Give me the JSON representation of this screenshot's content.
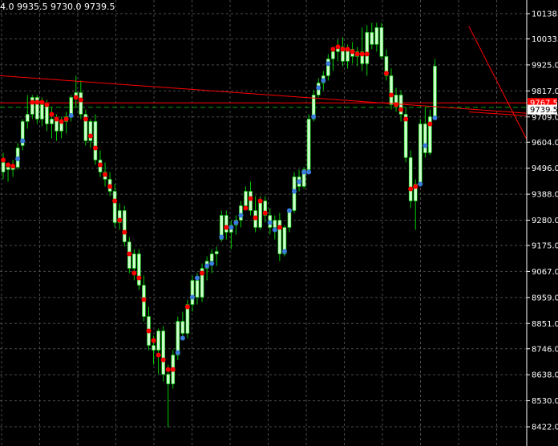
{
  "ohlc_readout": "4.0 9935.5 9730.0 9739.5",
  "colors": {
    "background": "#000000",
    "grid": "#4a4a4a",
    "axis": "#ffffff",
    "candle_body": "#ccffcc",
    "wick": "#00cc00",
    "dot_red": "#ff0000",
    "dot_blue": "#3b7bdc",
    "trendline": "#ff0000",
    "hline_red": "#ff0000",
    "hline_green": "#00a000",
    "tag_red": "#ff0000",
    "tag_bg_white": "#ffffff"
  },
  "chart_data": {
    "type": "candlestick",
    "ylim": [
      8380,
      10200
    ],
    "y_ticks": [
      "10138.0",
      "10033.0",
      "9925.0",
      "9817.0",
      "9709.0",
      "9604.0",
      "9496.0",
      "9388.0",
      "9280.0",
      "9175.0",
      "9067.0",
      "8959.0",
      "8851.0",
      "8746.0",
      "8638.0",
      "8530.0",
      "8422.0"
    ],
    "y_tick_values": [
      10138,
      10033,
      9925,
      9817,
      9709,
      9604,
      9496,
      9388,
      9280,
      9175,
      9067,
      8959,
      8851,
      8746,
      8638,
      8530,
      8422
    ],
    "price_tags": [
      {
        "label": "9767.5",
        "value": 9767.5,
        "style": "red"
      },
      {
        "label": "9739.5",
        "value": 9739.5,
        "style": "white"
      }
    ],
    "horizontal_lines": [
      {
        "value": 9767.5,
        "style": "red"
      },
      {
        "value": 9749,
        "style": "green-dashed"
      }
    ],
    "trendlines": [
      {
        "p1": [
          0,
          9880
        ],
        "p2": [
          111,
          9720
        ]
      },
      {
        "p1": [
          96,
          10085
        ],
        "p2": [
          111,
          9495
        ]
      },
      {
        "p1": [
          96,
          9730
        ],
        "p2": [
          111,
          9710
        ]
      }
    ],
    "candles": [
      {
        "o": 9520,
        "h": 9560,
        "l": 9450,
        "c": 9480,
        "dot": "red",
        "dv": 9530
      },
      {
        "o": 9490,
        "h": 9510,
        "l": 9440,
        "c": 9500,
        "dot": "red",
        "dv": 9510
      },
      {
        "o": 9500,
        "h": 9530,
        "l": 9460,
        "c": 9490,
        "dot": "red",
        "dv": 9505
      },
      {
        "o": 9500,
        "h": 9600,
        "l": 9490,
        "c": 9580,
        "dot": "blue",
        "dv": 9535
      },
      {
        "o": 9590,
        "h": 9700,
        "l": 9570,
        "c": 9690,
        "dot": "blue",
        "dv": 9610
      },
      {
        "o": 9690,
        "h": 9800,
        "l": 9660,
        "c": 9720,
        "dot": null,
        "dv": 0
      },
      {
        "o": 9720,
        "h": 9800,
        "l": 9700,
        "c": 9790,
        "dot": "red",
        "dv": 9770
      },
      {
        "o": 9790,
        "h": 9800,
        "l": 9680,
        "c": 9700,
        "dot": "red",
        "dv": 9770
      },
      {
        "o": 9700,
        "h": 9790,
        "l": 9670,
        "c": 9760,
        "dot": "red",
        "dv": 9770
      },
      {
        "o": 9760,
        "h": 9780,
        "l": 9650,
        "c": 9680,
        "dot": "red",
        "dv": 9760
      },
      {
        "o": 9680,
        "h": 9750,
        "l": 9620,
        "c": 9700,
        "dot": "red",
        "dv": 9720
      },
      {
        "o": 9700,
        "h": 9720,
        "l": 9610,
        "c": 9650,
        "dot": "red",
        "dv": 9700
      },
      {
        "o": 9650,
        "h": 9710,
        "l": 9620,
        "c": 9690,
        "dot": "red",
        "dv": 9690
      },
      {
        "o": 9690,
        "h": 9730,
        "l": 9640,
        "c": 9710,
        "dot": "red",
        "dv": 9700
      },
      {
        "o": 9710,
        "h": 9800,
        "l": 9690,
        "c": 9790,
        "dot": "blue",
        "dv": 9715
      },
      {
        "o": 9790,
        "h": 9880,
        "l": 9750,
        "c": 9810,
        "dot": "red",
        "dv": 9790
      },
      {
        "o": 9810,
        "h": 9860,
        "l": 9700,
        "c": 9720,
        "dot": "red",
        "dv": 9780
      },
      {
        "o": 9720,
        "h": 9740,
        "l": 9590,
        "c": 9610,
        "dot": "red",
        "dv": 9700
      },
      {
        "o": 9610,
        "h": 9700,
        "l": 9580,
        "c": 9690,
        "dot": "red",
        "dv": 9630
      },
      {
        "o": 9690,
        "h": 9720,
        "l": 9510,
        "c": 9530,
        "dot": "red",
        "dv": 9580
      },
      {
        "o": 9530,
        "h": 9570,
        "l": 9460,
        "c": 9480,
        "dot": "red",
        "dv": 9510
      },
      {
        "o": 9480,
        "h": 9520,
        "l": 9420,
        "c": 9450,
        "dot": "red",
        "dv": 9470
      },
      {
        "o": 9450,
        "h": 9480,
        "l": 9380,
        "c": 9400,
        "dot": "red",
        "dv": 9420
      },
      {
        "o": 9400,
        "h": 9430,
        "l": 9250,
        "c": 9270,
        "dot": "red",
        "dv": 9360
      },
      {
        "o": 9270,
        "h": 9350,
        "l": 9240,
        "c": 9320,
        "dot": "red",
        "dv": 9280
      },
      {
        "o": 9320,
        "h": 9340,
        "l": 9170,
        "c": 9190,
        "dot": "red",
        "dv": 9230
      },
      {
        "o": 9190,
        "h": 9210,
        "l": 9060,
        "c": 9080,
        "dot": "red",
        "dv": 9140
      },
      {
        "o": 9080,
        "h": 9160,
        "l": 9030,
        "c": 9140,
        "dot": "red",
        "dv": 9060
      },
      {
        "o": 9140,
        "h": 9160,
        "l": 8990,
        "c": 9010,
        "dot": "red",
        "dv": 9040
      },
      {
        "o": 9010,
        "h": 9050,
        "l": 8860,
        "c": 8880,
        "dot": "red",
        "dv": 8950
      },
      {
        "o": 8880,
        "h": 8920,
        "l": 8740,
        "c": 8760,
        "dot": "red",
        "dv": 8820
      },
      {
        "o": 8760,
        "h": 8800,
        "l": 8680,
        "c": 8740,
        "dot": "red",
        "dv": 8780
      },
      {
        "o": 8740,
        "h": 8830,
        "l": 8640,
        "c": 8820,
        "dot": "red",
        "dv": 8720
      },
      {
        "o": 8820,
        "h": 8840,
        "l": 8610,
        "c": 8640,
        "dot": "red",
        "dv": 8700
      },
      {
        "o": 8640,
        "h": 8680,
        "l": 8420,
        "c": 8600,
        "dot": "red",
        "dv": 8660
      },
      {
        "o": 8600,
        "h": 8740,
        "l": 8580,
        "c": 8720,
        "dot": "red",
        "dv": 8660
      },
      {
        "o": 8720,
        "h": 8880,
        "l": 8700,
        "c": 8860,
        "dot": "blue",
        "dv": 8730
      },
      {
        "o": 8860,
        "h": 8900,
        "l": 8780,
        "c": 8810,
        "dot": "blue",
        "dv": 8790
      },
      {
        "o": 8810,
        "h": 8950,
        "l": 8790,
        "c": 8930,
        "dot": "red",
        "dv": 8920
      },
      {
        "o": 8930,
        "h": 9050,
        "l": 8900,
        "c": 9030,
        "dot": "blue",
        "dv": 8960
      },
      {
        "o": 9030,
        "h": 9060,
        "l": 8930,
        "c": 8960,
        "dot": "blue",
        "dv": 9040
      },
      {
        "o": 8960,
        "h": 9100,
        "l": 8940,
        "c": 9080,
        "dot": "red",
        "dv": 9060
      },
      {
        "o": 9080,
        "h": 9130,
        "l": 9030,
        "c": 9110,
        "dot": "blue",
        "dv": 9090
      },
      {
        "o": 9110,
        "h": 9160,
        "l": 9060,
        "c": 9140,
        "dot": "blue",
        "dv": 9100
      },
      {
        "o": 9140,
        "h": 9170,
        "l": 9090,
        "c": 9150,
        "dot": null,
        "dv": 0
      },
      {
        "o": 9200,
        "h": 9320,
        "l": 9190,
        "c": 9300,
        "dot": "blue",
        "dv": 9210
      },
      {
        "o": 9300,
        "h": 9320,
        "l": 9200,
        "c": 9230,
        "dot": "red",
        "dv": 9250
      },
      {
        "o": 9230,
        "h": 9280,
        "l": 9160,
        "c": 9260,
        "dot": "blue",
        "dv": 9250
      },
      {
        "o": 9260,
        "h": 9300,
        "l": 9220,
        "c": 9280,
        "dot": "blue",
        "dv": 9270
      },
      {
        "o": 9280,
        "h": 9360,
        "l": 9250,
        "c": 9340,
        "dot": "blue",
        "dv": 9300
      },
      {
        "o": 9340,
        "h": 9420,
        "l": 9320,
        "c": 9400,
        "dot": "red",
        "dv": 9330
      },
      {
        "o": 9400,
        "h": 9440,
        "l": 9300,
        "c": 9320,
        "dot": "red",
        "dv": 9370
      },
      {
        "o": 9320,
        "h": 9380,
        "l": 9230,
        "c": 9250,
        "dot": "red",
        "dv": 9290
      },
      {
        "o": 9250,
        "h": 9380,
        "l": 9240,
        "c": 9360,
        "dot": "red",
        "dv": 9360
      },
      {
        "o": 9360,
        "h": 9380,
        "l": 9270,
        "c": 9300,
        "dot": "red",
        "dv": 9310
      },
      {
        "o": 9300,
        "h": 9330,
        "l": 9220,
        "c": 9250,
        "dot": "blue",
        "dv": 9270
      },
      {
        "o": 9250,
        "h": 9300,
        "l": 9200,
        "c": 9280,
        "dot": "blue",
        "dv": 9240
      },
      {
        "o": 9280,
        "h": 9310,
        "l": 9110,
        "c": 9140,
        "dot": "red",
        "dv": 9250
      },
      {
        "o": 9140,
        "h": 9260,
        "l": 9130,
        "c": 9250,
        "dot": "blue",
        "dv": 9150
      },
      {
        "o": 9250,
        "h": 9330,
        "l": 9230,
        "c": 9320,
        "dot": "blue",
        "dv": 9320
      },
      {
        "o": 9320,
        "h": 9480,
        "l": 9310,
        "c": 9460,
        "dot": "blue",
        "dv": 9400
      },
      {
        "o": 9460,
        "h": 9490,
        "l": 9400,
        "c": 9420,
        "dot": "blue",
        "dv": 9440
      },
      {
        "o": 9420,
        "h": 9500,
        "l": 9410,
        "c": 9490,
        "dot": "blue",
        "dv": 9480
      },
      {
        "o": 9490,
        "h": 9720,
        "l": 9480,
        "c": 9700,
        "dot": "blue",
        "dv": 9480
      },
      {
        "o": 9700,
        "h": 9820,
        "l": 9690,
        "c": 9800,
        "dot": "blue",
        "dv": 9710
      },
      {
        "o": 9800,
        "h": 9870,
        "l": 9790,
        "c": 9850,
        "dot": "blue",
        "dv": 9830
      },
      {
        "o": 9850,
        "h": 9900,
        "l": 9820,
        "c": 9880,
        "dot": "blue",
        "dv": 9860
      },
      {
        "o": 9880,
        "h": 9970,
        "l": 9860,
        "c": 9950,
        "dot": "blue",
        "dv": 9930
      },
      {
        "o": 9950,
        "h": 10000,
        "l": 9900,
        "c": 9980,
        "dot": "red",
        "dv": 9990
      },
      {
        "o": 9980,
        "h": 10030,
        "l": 9940,
        "c": 10000,
        "dot": "red",
        "dv": 10000
      },
      {
        "o": 10000,
        "h": 10040,
        "l": 9920,
        "c": 9940,
        "dot": "red",
        "dv": 9990
      },
      {
        "o": 9940,
        "h": 10010,
        "l": 9910,
        "c": 9990,
        "dot": "red",
        "dv": 9990
      },
      {
        "o": 9990,
        "h": 10020,
        "l": 9930,
        "c": 9960,
        "dot": "red",
        "dv": 9980
      },
      {
        "o": 9960,
        "h": 10000,
        "l": 9920,
        "c": 9980,
        "dot": "red",
        "dv": 9970
      },
      {
        "o": 9980,
        "h": 10080,
        "l": 9900,
        "c": 9930,
        "dot": "red",
        "dv": 9970
      },
      {
        "o": 9930,
        "h": 10090,
        "l": 9880,
        "c": 10060,
        "dot": "red",
        "dv": 9970
      },
      {
        "o": 10060,
        "h": 10100,
        "l": 9990,
        "c": 10010,
        "dot": null,
        "dv": 0
      },
      {
        "o": 10010,
        "h": 10100,
        "l": 9980,
        "c": 10080,
        "dot": null,
        "dv": 0
      },
      {
        "o": 10080,
        "h": 10100,
        "l": 9950,
        "c": 9960,
        "dot": null,
        "dv": 0
      },
      {
        "o": 9960,
        "h": 9990,
        "l": 9860,
        "c": 9880,
        "dot": "red",
        "dv": 9890
      },
      {
        "o": 9880,
        "h": 9910,
        "l": 9740,
        "c": 9760,
        "dot": "red",
        "dv": 9800
      },
      {
        "o": 9760,
        "h": 9830,
        "l": 9730,
        "c": 9800,
        "dot": "red",
        "dv": 9760
      },
      {
        "o": 9800,
        "h": 9820,
        "l": 9690,
        "c": 9720,
        "dot": "red",
        "dv": 9740
      },
      {
        "o": 9720,
        "h": 9750,
        "l": 9520,
        "c": 9540,
        "dot": "red",
        "dv": 9700
      },
      {
        "o": 9540,
        "h": 9570,
        "l": 9330,
        "c": 9360,
        "dot": "red",
        "dv": 9410
      },
      {
        "o": 9360,
        "h": 9450,
        "l": 9240,
        "c": 9430,
        "dot": "red",
        "dv": 9420
      },
      {
        "o": 9430,
        "h": 9700,
        "l": 9420,
        "c": 9680,
        "dot": "blue",
        "dv": 9430
      },
      {
        "o": 9680,
        "h": 9750,
        "l": 9540,
        "c": 9560,
        "dot": "blue",
        "dv": 9590
      },
      {
        "o": 9560,
        "h": 9740,
        "l": 9550,
        "c": 9710,
        "dot": "red",
        "dv": 9680
      },
      {
        "o": 9710,
        "h": 9950,
        "l": 9700,
        "c": 9920,
        "dot": "blue",
        "dv": 9705
      }
    ]
  }
}
